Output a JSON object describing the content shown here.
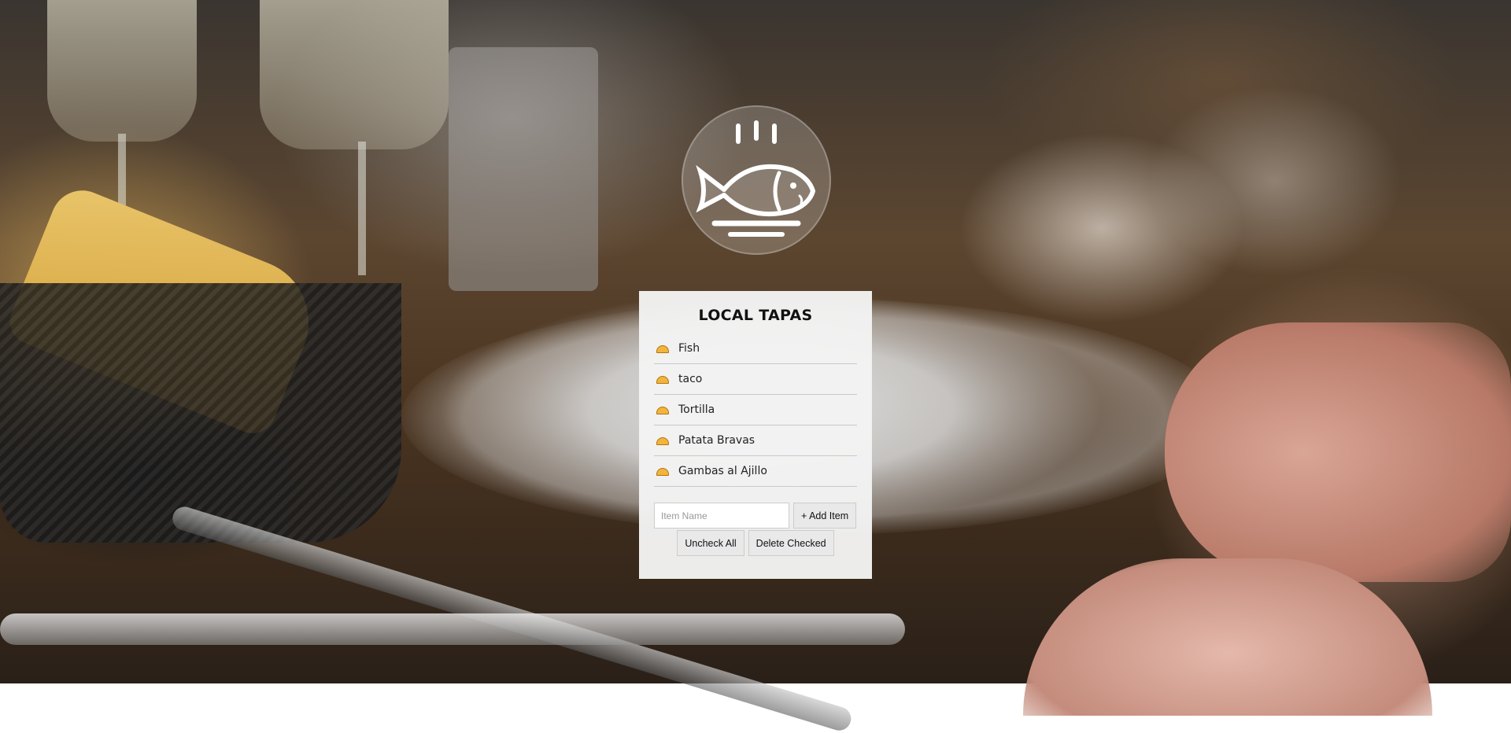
{
  "app": {
    "title": "LOCAL TAPAS",
    "logo_icon": "fish-on-plate-icon"
  },
  "items": [
    {
      "label": "Fish",
      "icon": "taco-icon"
    },
    {
      "label": "taco",
      "icon": "taco-icon"
    },
    {
      "label": "Tortilla",
      "icon": "taco-icon"
    },
    {
      "label": "Patata Bravas",
      "icon": "taco-icon"
    },
    {
      "label": "Gambas al Ajillo",
      "icon": "taco-icon"
    }
  ],
  "form": {
    "item_name_placeholder": "Item Name",
    "item_name_value": "",
    "add_button": "+ Add Item"
  },
  "actions": {
    "uncheck_all": "Uncheck All",
    "delete_checked": "Delete Checked"
  },
  "colors": {
    "card_background": "#f3f3f3",
    "taco_fill": "#f2b43b"
  }
}
